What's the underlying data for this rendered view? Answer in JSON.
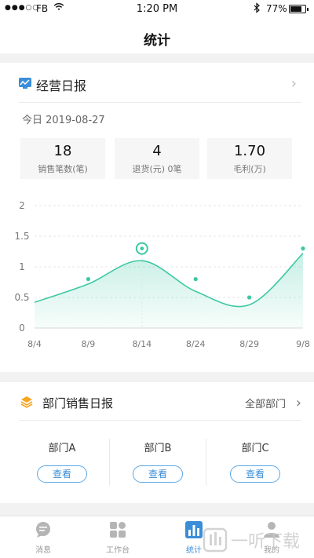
{
  "status_bar": {
    "carrier": "FB",
    "time": "1:20 PM",
    "battery": "77%",
    "battery_level": 0.77
  },
  "nav": {
    "title": "统计"
  },
  "report": {
    "title": "经营日报",
    "date": "今日 2019-08-27",
    "stats": [
      {
        "value": "18",
        "label": "销售笔数(笔)"
      },
      {
        "value": "4",
        "label": "退货(元) 0笔"
      },
      {
        "value": "1.70",
        "label": "毛利(万)"
      }
    ]
  },
  "chart_data": {
    "type": "area",
    "y_ticks": [
      "2",
      "1.5",
      "1",
      "0.5",
      "0"
    ],
    "x_ticks": [
      "8/4",
      "8/9",
      "8/14",
      "8/24",
      "8/29",
      "9/8"
    ],
    "ylim": [
      0,
      2
    ],
    "grid": true,
    "series": [
      {
        "x": [
          "8/4",
          "8/9",
          "8/14",
          "8/24",
          "8/29",
          "9/8"
        ],
        "y": [
          0.42,
          0.72,
          1.1,
          0.6,
          0.38,
          1.22
        ]
      }
    ],
    "markers": [
      {
        "x": "8/9",
        "y": 0.8
      },
      {
        "x": "8/14",
        "y": 1.3,
        "highlight": true
      },
      {
        "x": "8/24",
        "y": 0.8
      },
      {
        "x": "8/29",
        "y": 0.5
      },
      {
        "x": "9/8",
        "y": 1.3
      }
    ],
    "color": "#3cc8a2"
  },
  "dept_report": {
    "title": "部门销售日报",
    "all_label": "全部部门",
    "departments": [
      {
        "name": "部门A",
        "button": "查看"
      },
      {
        "name": "部门B",
        "button": "查看"
      },
      {
        "name": "部门C",
        "button": "查看"
      }
    ]
  },
  "tabs": [
    {
      "label": "消息",
      "icon": "chat-icon"
    },
    {
      "label": "工作台",
      "icon": "grid-icon"
    },
    {
      "label": "统计",
      "icon": "bar-chart-icon",
      "active": true
    },
    {
      "label": "我的",
      "icon": "user-icon"
    }
  ],
  "watermark": {
    "text": "一听下载"
  },
  "colors": {
    "accent": "#3a8ed9",
    "chart": "#3cc8a2"
  }
}
